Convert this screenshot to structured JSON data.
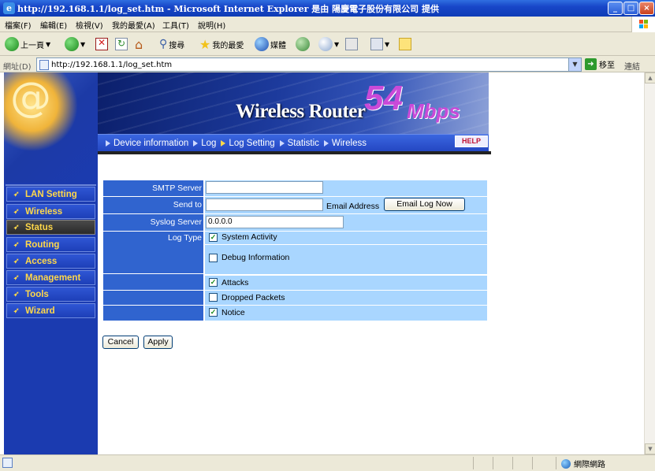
{
  "window": {
    "title": "http://192.168.1.1/log_set.htm - Microsoft Internet Explorer 是由 陽慶電子股份有限公司 提供",
    "minimize": "_",
    "maximize": "□",
    "close": "×"
  },
  "menubar": {
    "items": [
      "檔案(F)",
      "編輯(E)",
      "檢視(V)",
      "我的最愛(A)",
      "工具(T)",
      "說明(H)"
    ]
  },
  "toolbar": {
    "back_label": "上一頁",
    "search_label": "搜尋",
    "favorites_label": "我的最愛",
    "media_label": "媒體"
  },
  "address": {
    "label": "網址(D)",
    "url": "http://192.168.1.1/log_set.htm",
    "go_label": "移至",
    "links_label": "連結"
  },
  "banner": {
    "brand": "Wireless Router",
    "speed_num": "54",
    "speed_unit": "Mbps",
    "help_label": "HELP"
  },
  "tabs": [
    "Device information",
    "Log",
    "Log Setting",
    "Statistic",
    "Wireless"
  ],
  "active_tab": "Log Setting",
  "sidebar": {
    "items": [
      "LAN Setting",
      "Wireless",
      "Status",
      "Routing",
      "Access",
      "Management",
      "Tools",
      "Wizard"
    ],
    "active": "Status"
  },
  "form": {
    "smtp_label": "SMTP Server",
    "smtp_value": "",
    "sendto_label": "Send to",
    "sendto_value": "",
    "email_address_label": "Email Address",
    "email_log_now_label": "Email Log Now",
    "syslog_label": "Syslog Server",
    "syslog_value": "0.0.0.0",
    "logtype_label": "Log Type",
    "log_types": [
      {
        "label": "System Activity",
        "checked": true
      },
      {
        "label": "Debug Information",
        "checked": false
      },
      {
        "label": "Attacks",
        "checked": true
      },
      {
        "label": "Dropped Packets",
        "checked": false
      },
      {
        "label": "Notice",
        "checked": true
      }
    ],
    "cancel_label": "Cancel",
    "apply_label": "Apply"
  },
  "statusbar": {
    "zone": "網際網路"
  },
  "colors": {
    "label_bg": "#3064cf",
    "value_bg": "#a9d6ff",
    "sidebar_bg": "#1b3bb0",
    "nav_text": "#ffd84a"
  }
}
